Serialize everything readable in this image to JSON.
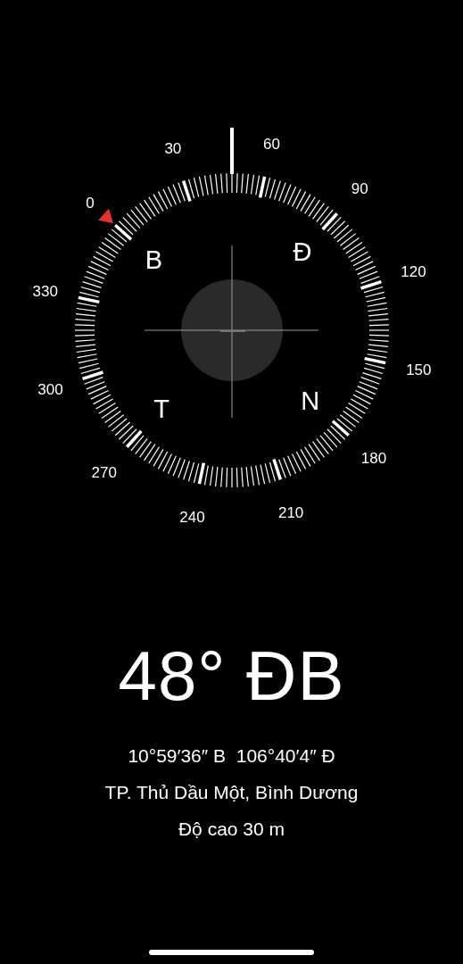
{
  "compass": {
    "degree_labels": [
      "0",
      "30",
      "60",
      "90",
      "120",
      "150",
      "180",
      "210",
      "240",
      "270",
      "300",
      "330"
    ],
    "cardinal_labels": [
      "B",
      "Đ",
      "T",
      "N"
    ]
  },
  "heading": "48° ĐB",
  "coordinates": "10°59′36″ B  106°40′4″ Đ",
  "location": "TP. Thủ Dầu Một, Bình Dương",
  "altitude": "Độ cao 30 m"
}
